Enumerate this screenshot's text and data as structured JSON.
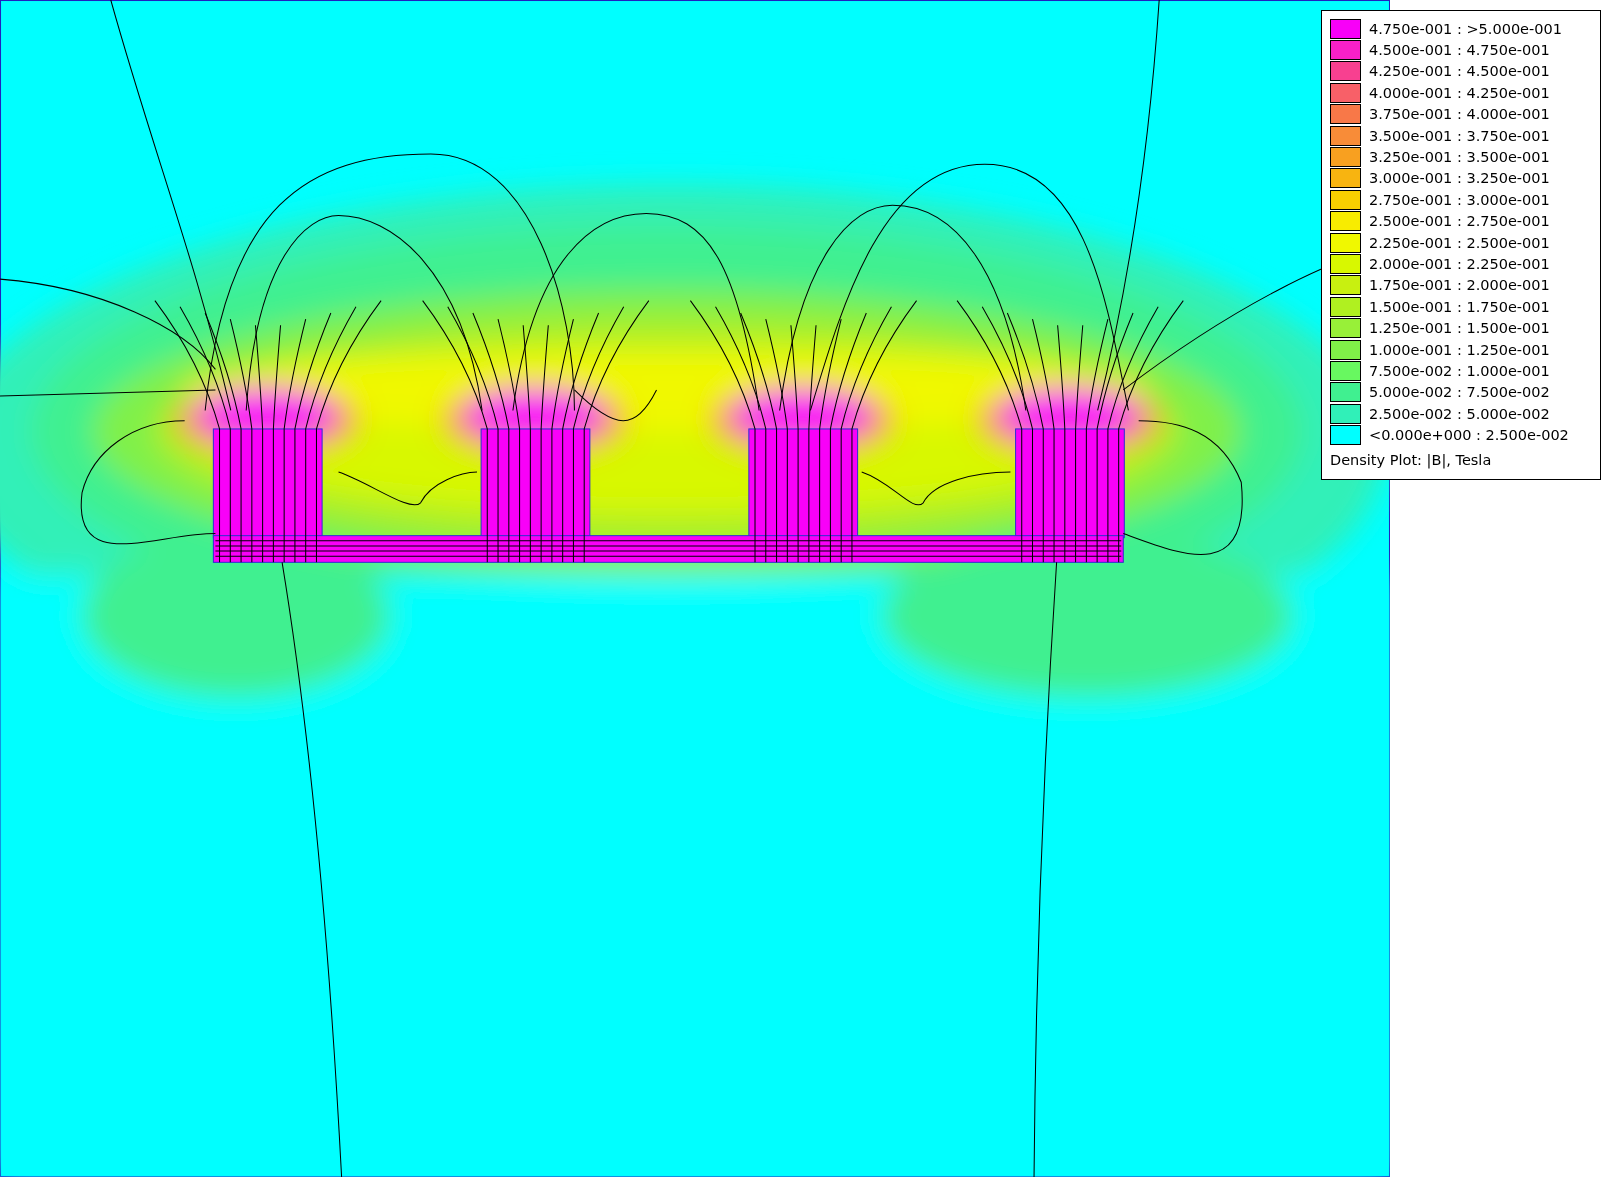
{
  "legend": {
    "entries": [
      {
        "label": "4.750e-001 : >5.000e-001",
        "color": "#f800f8"
      },
      {
        "label": "4.500e-001 : 4.750e-001",
        "color": "#f820c8"
      },
      {
        "label": "4.250e-001 : 4.500e-001",
        "color": "#f84090"
      },
      {
        "label": "4.000e-001 : 4.250e-001",
        "color": "#f86068"
      },
      {
        "label": "3.750e-001 : 4.000e-001",
        "color": "#f87848"
      },
      {
        "label": "3.500e-001 : 3.750e-001",
        "color": "#f88c38"
      },
      {
        "label": "3.250e-001 : 3.500e-001",
        "color": "#f8a020"
      },
      {
        "label": "3.000e-001 : 3.250e-001",
        "color": "#f8b410"
      },
      {
        "label": "2.750e-001 : 3.000e-001",
        "color": "#f8d000"
      },
      {
        "label": "2.500e-001 : 2.750e-001",
        "color": "#f8ec00"
      },
      {
        "label": "2.250e-001 : 2.500e-001",
        "color": "#f0f800"
      },
      {
        "label": "2.000e-001 : 2.250e-001",
        "color": "#d8f800"
      },
      {
        "label": "1.750e-001 : 2.000e-001",
        "color": "#c8f010"
      },
      {
        "label": "1.500e-001 : 1.750e-001",
        "color": "#b0f020"
      },
      {
        "label": "1.250e-001 : 1.500e-001",
        "color": "#98f038"
      },
      {
        "label": "1.000e-001 : 1.250e-001",
        "color": "#80f048"
      },
      {
        "label": "7.500e-002 : 1.000e-001",
        "color": "#68f860"
      },
      {
        "label": "5.000e-002 : 7.500e-002",
        "color": "#40f090"
      },
      {
        "label": "2.500e-002 : 5.000e-002",
        "color": "#30f0b8"
      },
      {
        "label": "<0.000e+000 : 2.500e-002",
        "color": "#00ffff"
      }
    ],
    "title": "Density Plot: |B|, Tesla"
  }
}
